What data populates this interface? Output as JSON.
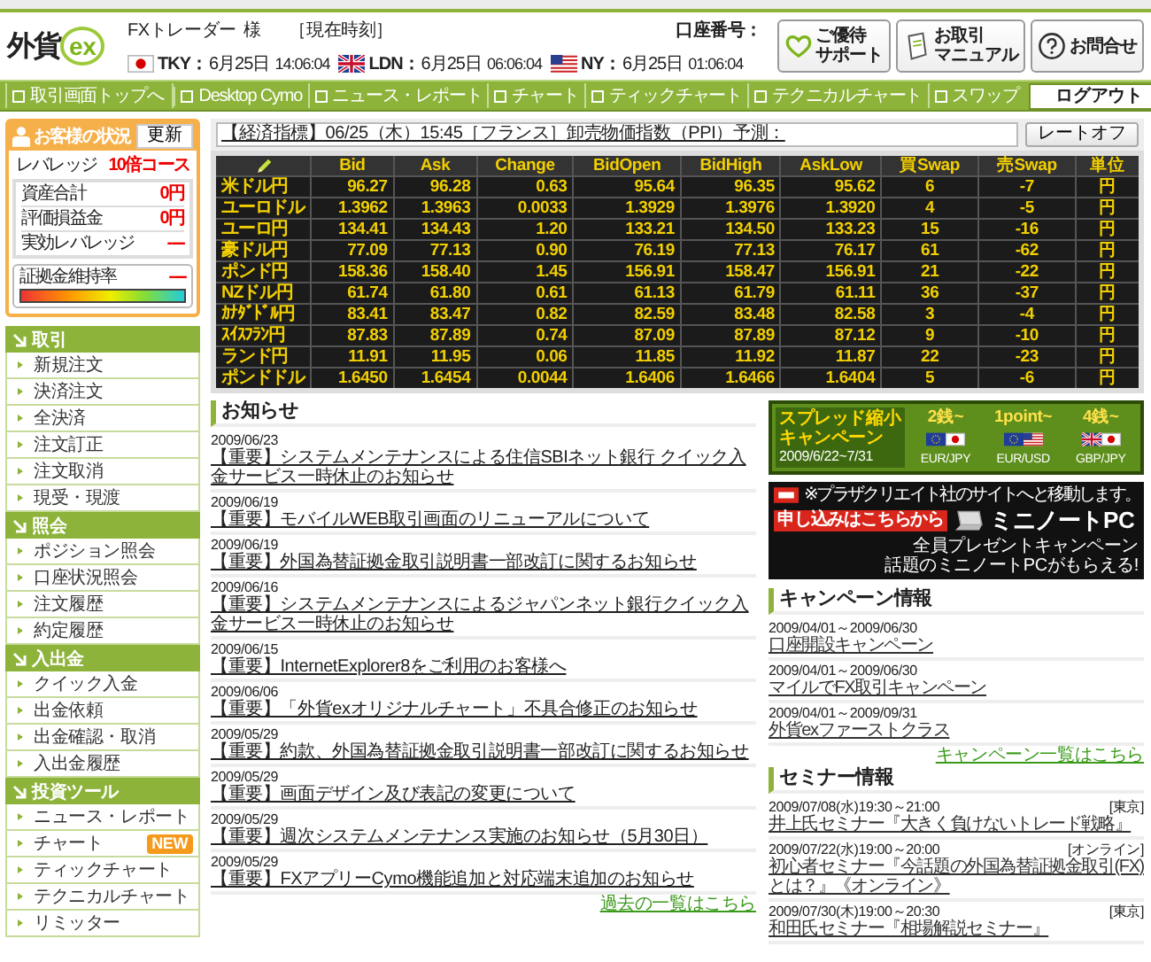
{
  "header": {
    "logo_text": "外貨",
    "logo_mark": "ex",
    "user": "FXトレーダー",
    "honorific": "様",
    "account_label": "口座番号：",
    "clock_label": "［現在時刻］",
    "clocks": [
      {
        "kind": "jp",
        "city": "TKY：",
        "date": "6月25日",
        "time": "14:06:04"
      },
      {
        "kind": "uk",
        "city": "LDN：",
        "date": "6月25日",
        "time": "06:06:04"
      },
      {
        "kind": "us",
        "city": "NY：",
        "date": "6月25日",
        "time": "01:06:04"
      }
    ],
    "buttons": [
      {
        "kind": "support",
        "lines": [
          "ご優待",
          "サポート"
        ]
      },
      {
        "kind": "manual",
        "lines": [
          "お取引",
          "マニュアル"
        ]
      },
      {
        "kind": "contact",
        "lines": [
          "お問合せ"
        ]
      }
    ]
  },
  "nav": [
    {
      "kind": "top",
      "label": "取引画面トップへ"
    },
    {
      "kind": "link",
      "label": "Desktop Cymo"
    },
    {
      "kind": "link",
      "label": "ニュース・レポート"
    },
    {
      "kind": "link",
      "label": "チャート"
    },
    {
      "kind": "link",
      "label": "ティックチャート"
    },
    {
      "kind": "link",
      "label": "テクニカルチャート"
    },
    {
      "kind": "link",
      "label": "スワップ"
    },
    {
      "kind": "logout",
      "label": "ログアウト"
    }
  ],
  "status": {
    "title": "お客様の状況",
    "refresh": "更新",
    "leverage_label": "レバレッジ",
    "leverage_value": "10倍コース",
    "rows": [
      {
        "label": "資産合計",
        "value": "0円"
      },
      {
        "label": "評価損益金",
        "value": "0円"
      },
      {
        "label": "実効レバレッジ",
        "value": "----"
      }
    ],
    "margin_label": "証拠金維持率",
    "margin_value": "----"
  },
  "menu": [
    {
      "title": "取引",
      "items": [
        {
          "label": "新規注文"
        },
        {
          "label": "決済注文"
        },
        {
          "label": "全決済"
        },
        {
          "label": "注文訂正"
        },
        {
          "label": "注文取消"
        },
        {
          "label": "現受・現渡"
        }
      ]
    },
    {
      "title": "照会",
      "items": [
        {
          "label": "ポジション照会"
        },
        {
          "label": "口座状況照会"
        },
        {
          "label": "注文履歴"
        },
        {
          "label": "約定履歴"
        }
      ]
    },
    {
      "title": "入出金",
      "items": [
        {
          "label": "クイック入金"
        },
        {
          "label": "出金依頼"
        },
        {
          "label": "出金確認・取消"
        },
        {
          "label": "入出金履歴"
        }
      ]
    },
    {
      "title": "投資ツール",
      "items": [
        {
          "label": "ニュース・レポート"
        },
        {
          "label": "チャート",
          "badge": "NEW"
        },
        {
          "label": "ティックチャート"
        },
        {
          "label": "テクニカルチャート"
        },
        {
          "label": "リミッター"
        }
      ]
    }
  ],
  "ticker": {
    "text": "【経済指標】06/25（木）15:45［フランス］卸売物価指数（PPI）予測：",
    "button": "レートオフ"
  },
  "rates": {
    "columns": [
      "Bid",
      "Ask",
      "Change",
      "BidOpen",
      "BidHigh",
      "AskLow",
      "買Swap",
      "売Swap",
      "単位"
    ],
    "rows": [
      {
        "pair": "米ドル円",
        "cells": [
          "96.27",
          "96.28",
          "0.63",
          "95.64",
          "96.35",
          "95.62",
          "6",
          "-7",
          "円"
        ]
      },
      {
        "pair": "ユーロドル",
        "cells": [
          "1.3962",
          "1.3963",
          "0.0033",
          "1.3929",
          "1.3976",
          "1.3920",
          "4",
          "-5",
          "円"
        ]
      },
      {
        "pair": "ユーロ円",
        "cells": [
          "134.41",
          "134.43",
          "1.20",
          "133.21",
          "134.50",
          "133.23",
          "15",
          "-16",
          "円"
        ]
      },
      {
        "pair": "豪ドル円",
        "cells": [
          "77.09",
          "77.13",
          "0.90",
          "76.19",
          "77.13",
          "76.17",
          "61",
          "-62",
          "円"
        ]
      },
      {
        "pair": "ポンド円",
        "cells": [
          "158.36",
          "158.40",
          "1.45",
          "156.91",
          "158.47",
          "156.91",
          "21",
          "-22",
          "円"
        ]
      },
      {
        "pair": "NZドル円",
        "cells": [
          "61.74",
          "61.80",
          "0.61",
          "61.13",
          "61.79",
          "61.11",
          "36",
          "-37",
          "円"
        ]
      },
      {
        "pair": "ｶﾅﾀﾞﾄﾞﾙ円",
        "cells": [
          "83.41",
          "83.47",
          "0.82",
          "82.59",
          "83.48",
          "82.58",
          "3",
          "-4",
          "円"
        ]
      },
      {
        "pair": "ｽｲｽﾌﾗﾝ円",
        "cells": [
          "87.83",
          "87.89",
          "0.74",
          "87.09",
          "87.89",
          "87.12",
          "9",
          "-10",
          "円"
        ]
      },
      {
        "pair": "ランド円",
        "cells": [
          "11.91",
          "11.95",
          "0.06",
          "11.85",
          "11.92",
          "11.87",
          "22",
          "-23",
          "円"
        ]
      },
      {
        "pair": "ポンドドル",
        "cells": [
          "1.6450",
          "1.6454",
          "0.0044",
          "1.6406",
          "1.6466",
          "1.6404",
          "5",
          "-6",
          "円"
        ]
      }
    ]
  },
  "news": {
    "title": "お知らせ",
    "more": "過去の一覧はこちら",
    "items": [
      {
        "date": "2009/06/23",
        "title": "【重要】システムメンテナンスによる住信SBIネット銀行 クイック入金サービス一時休止のお知らせ"
      },
      {
        "date": "2009/06/19",
        "title": "【重要】モバイルWEB取引画面のリニューアルについて"
      },
      {
        "date": "2009/06/19",
        "title": "【重要】外国為替証拠金取引説明書一部改訂に関するお知らせ"
      },
      {
        "date": "2009/06/16",
        "title": "【重要】システムメンテナンスによるジャパンネット銀行クイック入金サービス一時休止のお知らせ"
      },
      {
        "date": "2009/06/15",
        "title": "【重要】InternetExplorer8をご利用のお客様へ"
      },
      {
        "date": "2009/06/06",
        "title": "【重要】「外貨exオリジナルチャート」不具合修正のお知らせ"
      },
      {
        "date": "2009/05/29",
        "title": "【重要】約款、外国為替証拠金取引説明書一部改訂に関するお知らせ"
      },
      {
        "date": "2009/05/29",
        "title": "【重要】画面デザイン及び表記の変更について"
      },
      {
        "date": "2009/05/29",
        "title": "【重要】週次システムメンテナンス実施のお知らせ（5月30日）"
      },
      {
        "date": "2009/05/29",
        "title": "【重要】FXアプリーCymo機能追加と対応端末追加のお知らせ"
      }
    ]
  },
  "spread_banner": {
    "title": [
      "スプレッド縮小",
      "キャンペーン"
    ],
    "period": "2009/6/22~7/31",
    "offers": [
      {
        "spread": "2銭~",
        "pair": "EUR/JPY",
        "flags": [
          {
            "kind": "eu"
          },
          {
            "kind": "jp"
          }
        ]
      },
      {
        "spread": "1point~",
        "pair": "EUR/USD",
        "flags": [
          {
            "kind": "eu"
          },
          {
            "kind": "us"
          }
        ]
      },
      {
        "spread": "4銭~",
        "pair": "GBP/JPY",
        "flags": [
          {
            "kind": "uk"
          },
          {
            "kind": "jp"
          }
        ]
      }
    ]
  },
  "pc_banner": {
    "note": "※プラザクリエイト社のサイトへと移動します。",
    "title": "ミニノートPC",
    "subtitle": "全員プレゼントキャンペーン",
    "tagline": "話題のミニノートPCがもらえる!",
    "button": "申し込みはこちらから"
  },
  "campaigns": {
    "title": "キャンペーン情報",
    "more": "キャンペーン一覧はこちら",
    "items": [
      {
        "period": "2009/04/01～2009/06/30",
        "title": "口座開設キャンペーン"
      },
      {
        "period": "2009/04/01～2009/06/30",
        "title": "マイルでFX取引キャンペーン"
      },
      {
        "period": "2009/04/01～2009/09/31",
        "title": "外貨exファーストクラス"
      }
    ]
  },
  "seminars": {
    "title": "セミナー情報",
    "items": [
      {
        "date": "2009/07/08(水)19:30～21:00",
        "place": "[東京]",
        "title": "井上氏セミナー『大きく負けないトレード戦略』"
      },
      {
        "date": "2009/07/22(水)19:00～20:00",
        "place": "[オンライン]",
        "title": "初心者セミナー『今話題の外国為替証拠金取引(FX)とは？』《オンライン》"
      },
      {
        "date": "2009/07/30(木)19:00～20:30",
        "place": "[東京]",
        "title": "和田氏セミナー『相場解説セミナー』"
      }
    ]
  }
}
